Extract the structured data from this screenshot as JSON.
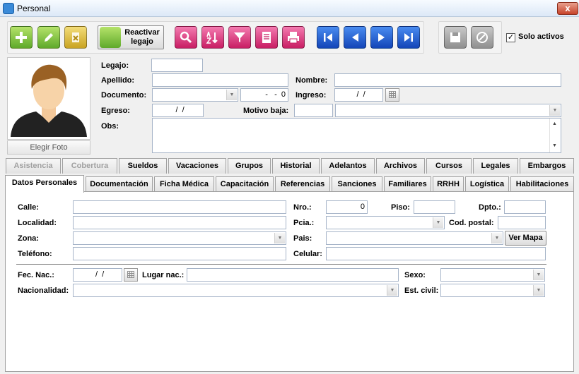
{
  "window": {
    "title": "Personal",
    "close_glyph": "x"
  },
  "toolbar": {
    "reactivar_label_1": "Reactivar",
    "reactivar_label_2": "legajo",
    "solo_activos_label": "Solo activos",
    "solo_activos_checked": true,
    "icons": [
      "add-icon",
      "edit-icon",
      "delete-icon",
      "reactivate-icon",
      "search-icon",
      "sort-az-icon",
      "filter-icon",
      "list-icon",
      "print-icon",
      "first-record-icon",
      "previous-record-icon",
      "next-record-icon",
      "last-record-icon",
      "save-icon",
      "cancel-icon"
    ]
  },
  "photo": {
    "button_label": "Elegir Foto"
  },
  "header_form": {
    "legajo_label": "Legajo:",
    "legajo_value": "",
    "apellido_label": "Apellido:",
    "apellido_value": "",
    "nombre_label": "Nombre:",
    "nombre_value": "",
    "documento_label": "Documento:",
    "documento_type_value": "",
    "documento_number_value": "  -   -  0",
    "ingreso_label": "Ingreso:",
    "ingreso_value": "  /  /",
    "egreso_label": "Egreso:",
    "egreso_value": "  /  /",
    "motivo_baja_label": "Motivo baja:",
    "motivo_baja_code": "",
    "motivo_baja_value": "",
    "obs_label": "Obs:",
    "obs_value": ""
  },
  "tabs_row1": [
    {
      "label": "Asistencia",
      "enabled": false
    },
    {
      "label": "Cobertura",
      "enabled": false
    },
    {
      "label": "Sueldos",
      "enabled": true
    },
    {
      "label": "Vacaciones",
      "enabled": true
    },
    {
      "label": "Grupos",
      "enabled": true
    },
    {
      "label": "Historial",
      "enabled": true
    },
    {
      "label": "Adelantos",
      "enabled": true
    },
    {
      "label": "Archivos",
      "enabled": true
    },
    {
      "label": "Cursos",
      "enabled": true
    },
    {
      "label": "Legales",
      "enabled": true
    },
    {
      "label": "Embargos",
      "enabled": true
    }
  ],
  "tabs_row2": [
    {
      "label": "Datos Personales",
      "active": true
    },
    {
      "label": "Documentación",
      "active": false
    },
    {
      "label": "Ficha Médica",
      "active": false
    },
    {
      "label": "Capacitación",
      "active": false
    },
    {
      "label": "Referencias",
      "active": false
    },
    {
      "label": "Sanciones",
      "active": false
    },
    {
      "label": "Familiares",
      "active": false
    },
    {
      "label": "RRHH",
      "active": false
    },
    {
      "label": "Logística",
      "active": false
    },
    {
      "label": "Habilitaciones",
      "active": false
    }
  ],
  "datos_personales": {
    "calle_label": "Calle:",
    "calle_value": "",
    "nro_label": "Nro.:",
    "nro_value": "0",
    "piso_label": "Piso:",
    "piso_value": "",
    "dpto_label": "Dpto.:",
    "dpto_value": "",
    "localidad_label": "Localidad:",
    "localidad_value": "",
    "pcia_label": "Pcia.:",
    "pcia_value": "",
    "cod_postal_label": "Cod. postal:",
    "cod_postal_value": "",
    "zona_label": "Zona:",
    "zona_value": "",
    "pais_label": "Pais:",
    "pais_value": "",
    "ver_mapa_label": "Ver Mapa",
    "telefono_label": "Teléfono:",
    "telefono_value": "",
    "celular_label": "Celular:",
    "celular_value": "",
    "fec_nac_label": "Fec. Nac.:",
    "fec_nac_value": "  /  /",
    "lugar_nac_label": "Lugar nac.:",
    "lugar_nac_value": "",
    "sexo_label": "Sexo:",
    "sexo_value": "",
    "nacionalidad_label": "Nacionalidad:",
    "nacionalidad_value": "",
    "est_civil_label": "Est. civil:",
    "est_civil_value": ""
  }
}
